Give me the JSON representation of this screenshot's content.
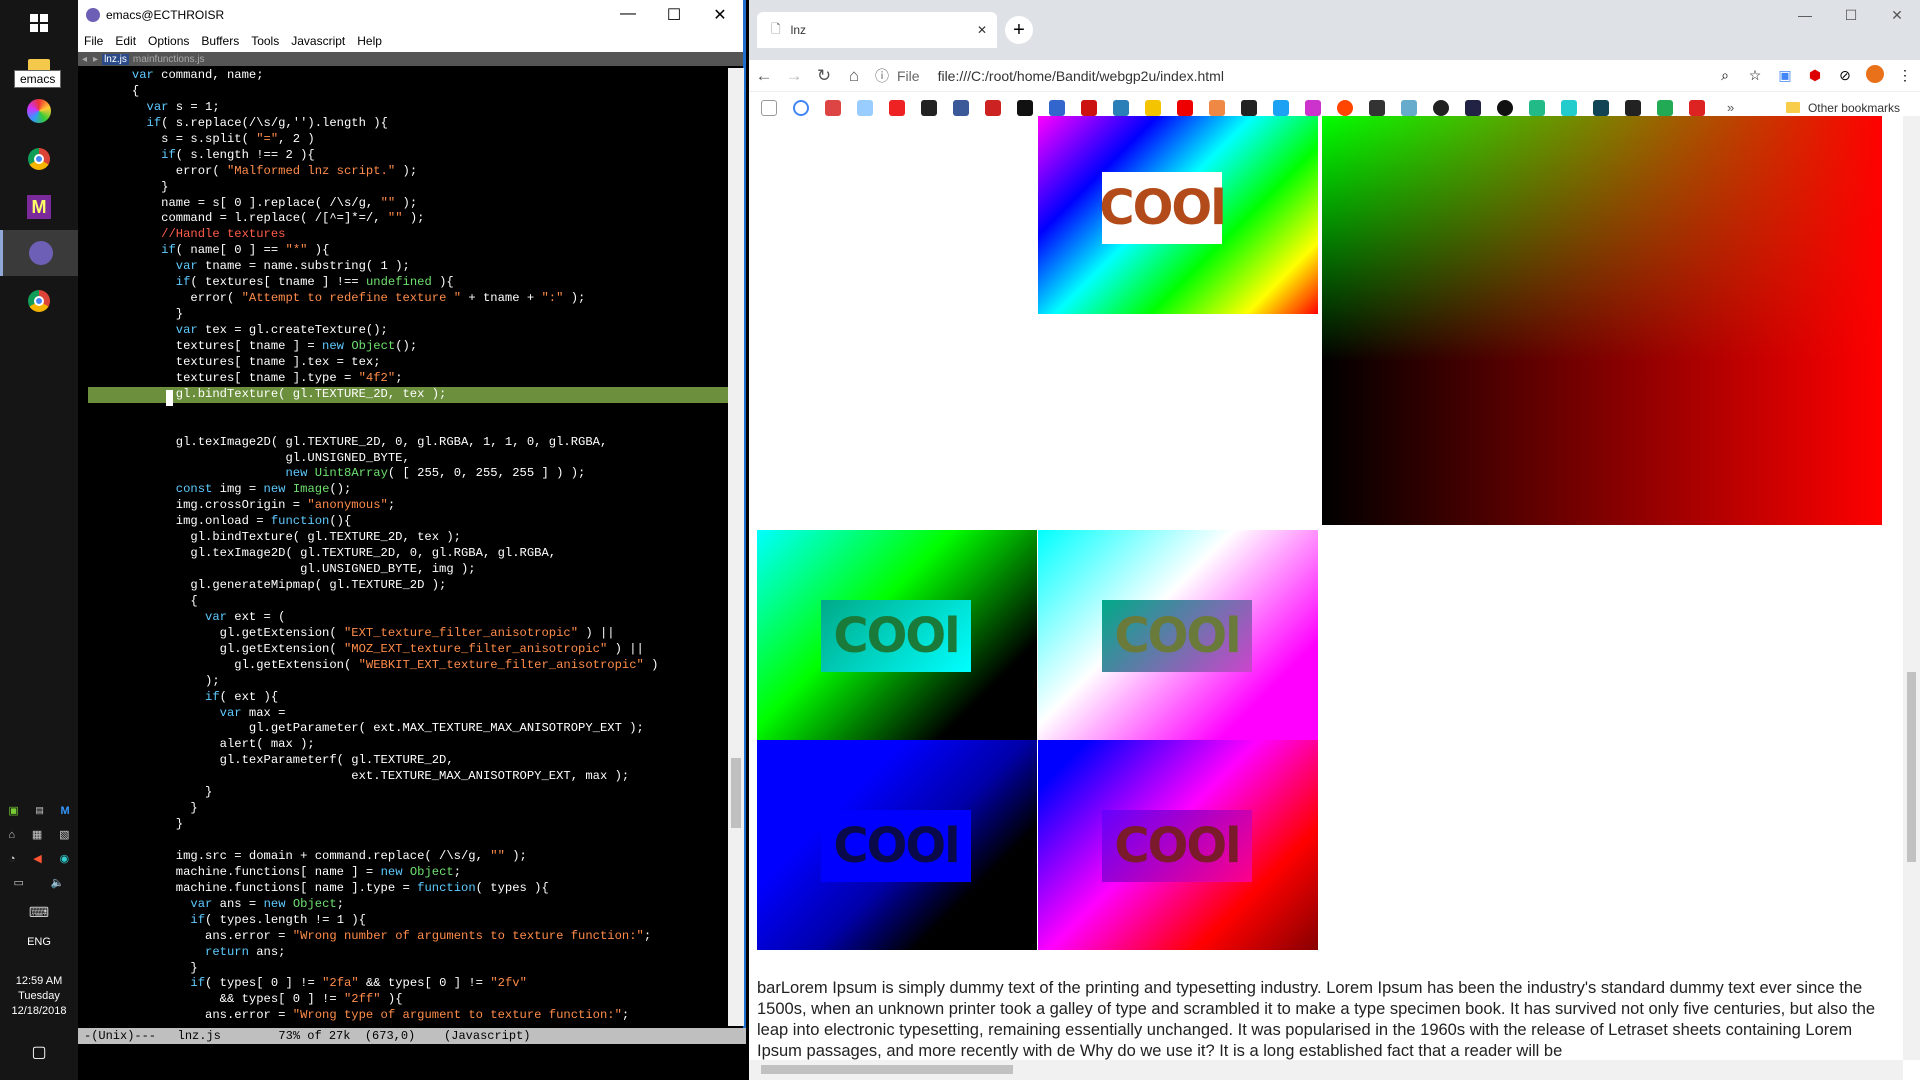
{
  "taskbar": {
    "tooltip": "emacs",
    "language": "ENG",
    "time": "12:59 AM",
    "day": "Tuesday",
    "date": "12/18/2018"
  },
  "emacs": {
    "title": "emacs@ECTHROISR",
    "menu": [
      "File",
      "Edit",
      "Options",
      "Buffers",
      "Tools",
      "Javascript",
      "Help"
    ],
    "tabs": {
      "current": "lnz.js",
      "other": "mainfunctions.js"
    },
    "modeline": "-(Unix)---   lnz.js        73% of 27k  (673,0)    (Javascript)",
    "code": [
      "      var command, name;",
      "      {",
      "        var s = 1;",
      "        if( s.replace(/\\s/g,'').length ){",
      "          s = s.split( \"=\", 2 )",
      "          if( s.length !== 2 ){",
      "            error( \"Malformed lnz script.\" );",
      "          }",
      "          name = s[ 0 ].replace( /\\s/g, \"\" );",
      "          command = l.replace( /[^=]*=/, \"\" );",
      "          //Handle textures",
      "          if( name[ 0 ] == \"*\" ){",
      "            var tname = name.substring( 1 );",
      "            if( textures[ tname ] !== undefined ){",
      "              error( \"Attempt to redefine texture \" + tname + \":\" );",
      "            }",
      "            var tex = gl.createTexture();",
      "            textures[ tname ] = new Object();",
      "            textures[ tname ].tex = tex;",
      "            textures[ tname ].type = \"4f2\";",
      "            gl.bindTexture( gl.TEXTURE_2D, tex );",
      "",
      "",
      "            gl.texImage2D( gl.TEXTURE_2D, 0, gl.RGBA, 1, 1, 0, gl.RGBA,",
      "                           gl.UNSIGNED_BYTE,",
      "                           new Uint8Array( [ 255, 0, 255, 255 ] ) );",
      "            const img = new Image();",
      "            img.crossOrigin = \"anonymous\";",
      "            img.onload = function(){",
      "              gl.bindTexture( gl.TEXTURE_2D, tex );",
      "              gl.texImage2D( gl.TEXTURE_2D, 0, gl.RGBA, gl.RGBA,",
      "                             gl.UNSIGNED_BYTE, img );",
      "              gl.generateMipmap( gl.TEXTURE_2D );",
      "              {",
      "                var ext = (",
      "                  gl.getExtension( \"EXT_texture_filter_anisotropic\" ) ||",
      "                  gl.getExtension( \"MOZ_EXT_texture_filter_anisotropic\" ) ||",
      "                    gl.getExtension( \"WEBKIT_EXT_texture_filter_anisotropic\" )",
      "                );",
      "                if( ext ){",
      "                  var max =",
      "                      gl.getParameter( ext.MAX_TEXTURE_MAX_ANISOTROPY_EXT );",
      "                  alert( max );",
      "                  gl.texParameterf( gl.TEXTURE_2D,",
      "                                    ext.TEXTURE_MAX_ANISOTROPY_EXT, max );",
      "                }",
      "              }",
      "            }",
      "",
      "            img.src = domain + command.replace( /\\s/g, \"\" );",
      "            machine.functions[ name ] = new Object;",
      "            machine.functions[ name ].type = function( types ){",
      "              var ans = new Object;",
      "              if( types.length != 1 ){",
      "                ans.error = \"Wrong number of arguments to texture function:\";",
      "                return ans;",
      "              }",
      "              if( types[ 0 ] != \"2fa\" && types[ 0 ] != \"2fv\"",
      "                  && types[ 0 ] != \"2ff\" ){",
      "                ans.error = \"Wrong type of argument to texture function:\";"
    ]
  },
  "browser": {
    "tab_title": "lnz",
    "url_scheme": "File",
    "url": "file:///C:/root/home/Bandit/webgp2u/index.html",
    "other_bookmarks": "Other bookmarks",
    "cool_text": "COOl",
    "paragraph": "barLorem Ipsum is simply dummy text of the printing and typesetting industry. Lorem Ipsum has been the industry's standard dummy text ever since the 1500s, when an unknown printer took a galley of type and scrambled it to make a type specimen book. It has survived not only five centuries, but also the leap into electronic typesetting, remaining essentially unchanged. It was popularised in the 1960s with the release of Letraset sheets containing Lorem Ipsum passages, and more recently with de Why do we use it? It is a long established fact that a reader will be"
  },
  "colors": {
    "emacs_keyword": "#5ecbff",
    "emacs_string": "#ff8c4a",
    "emacs_comment": "#ff5c4a",
    "emacs_highlight": "#6b8f3c",
    "window_border": "#1f6fd1"
  }
}
